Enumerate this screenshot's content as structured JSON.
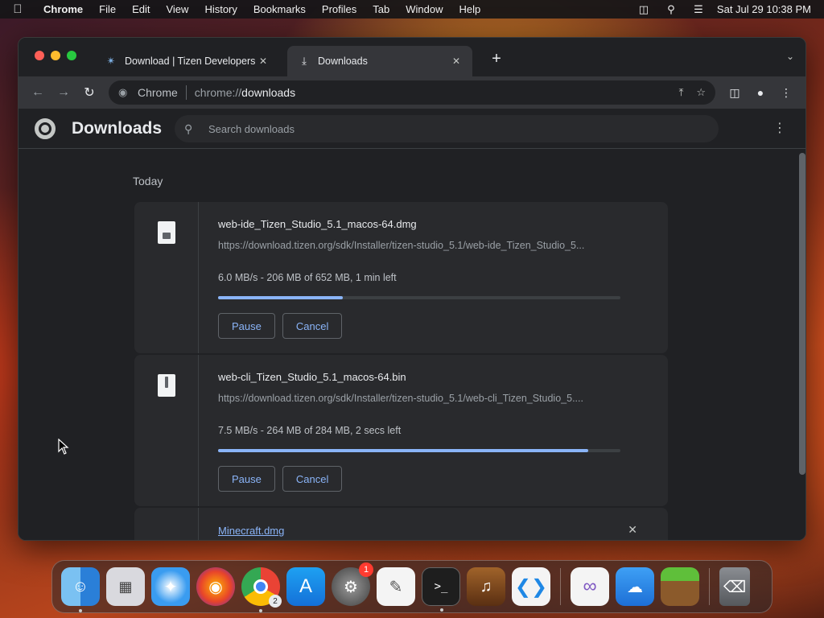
{
  "menubar": {
    "app_name": "Chrome",
    "menus": [
      "File",
      "Edit",
      "View",
      "History",
      "Bookmarks",
      "Profiles",
      "Tab",
      "Window",
      "Help"
    ],
    "clock": "Sat Jul 29  10:38 PM"
  },
  "tabs": [
    {
      "title": "Download | Tizen Developers",
      "icon": "tizen-star-icon",
      "active": false
    },
    {
      "title": "Downloads",
      "icon": "download-icon",
      "active": true
    }
  ],
  "omnibox": {
    "chip": "Chrome",
    "url_scheme": "chrome://",
    "url_path": "downloads"
  },
  "downloads_page": {
    "title": "Downloads",
    "search_placeholder": "Search downloads",
    "date_group": "Today",
    "items": [
      {
        "name": "web-ide_Tizen_Studio_5.1_macos-64.dmg",
        "url": "https://download.tizen.org/sdk/Installer/tizen-studio_5.1/web-ide_Tizen_Studio_5...",
        "status": "6.0 MB/s - 206 MB of 652 MB, 1 min left",
        "progress": 0.31,
        "pause_label": "Pause",
        "cancel_label": "Cancel"
      },
      {
        "name": "web-cli_Tizen_Studio_5.1_macos-64.bin",
        "url": "https://download.tizen.org/sdk/Installer/tizen-studio_5.1/web-cli_Tizen_Studio_5....",
        "status": "7.5 MB/s - 264 MB of 284 MB, 2 secs left",
        "progress": 0.92,
        "pause_label": "Pause",
        "cancel_label": "Cancel"
      },
      {
        "name": "Minecraft.dmg"
      }
    ]
  },
  "dock": {
    "badges": {
      "system_settings": "1",
      "chrome_windows": "2"
    }
  },
  "colors": {
    "accent": "#8ab4f8",
    "page_bg": "#202124",
    "card_bg": "#292a2d"
  }
}
